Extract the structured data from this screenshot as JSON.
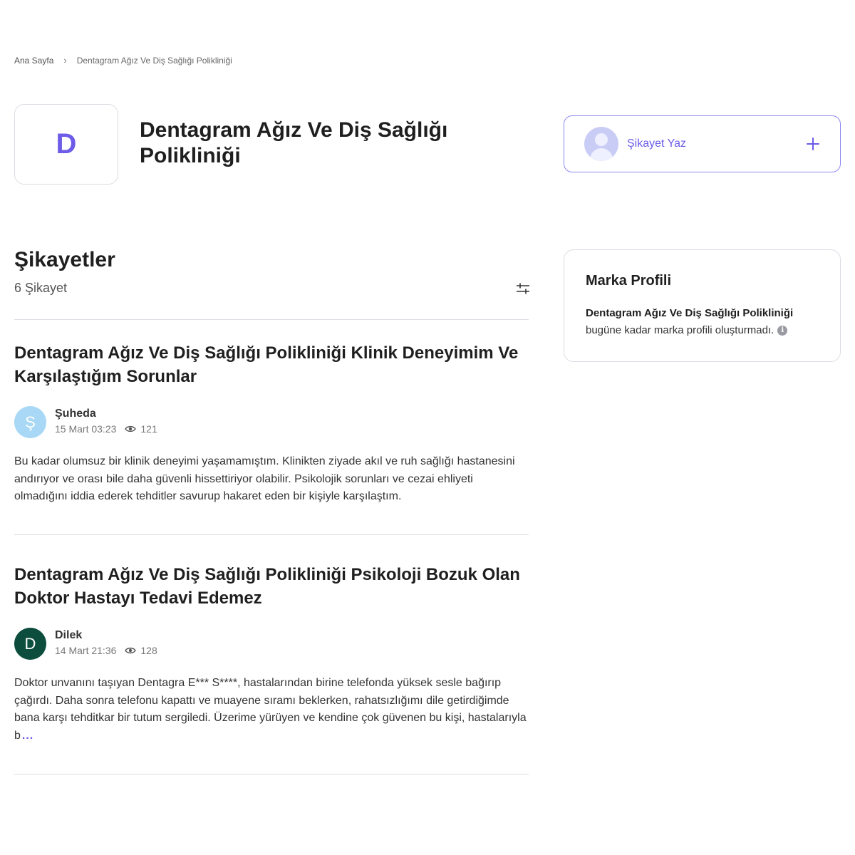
{
  "breadcrumb": {
    "home": "Ana Sayfa",
    "current": "Dentagram Ağız Ve Diş Sağlığı Polikliniği"
  },
  "brand": {
    "logo_letter": "D",
    "name": "Dentagram Ağız Ve Diş Sağlığı Polikliniği",
    "logo_color": "#6c5ce7"
  },
  "write_complaint": {
    "label": "Şikayet Yaz",
    "icon": "plus-icon"
  },
  "complaints_section": {
    "title": "Şikayetler",
    "count": "6 Şikayet",
    "filter_icon": "filter-sliders-icon"
  },
  "complaints": [
    {
      "title": "Dentagram Ağız Ve Diş Sağlığı Polikliniği Klinik Deneyimim Ve Karşılaştığım Sorunlar",
      "user": "Şuheda",
      "avatar_letter": "Ş",
      "avatar_bg": "#a8d8f5",
      "avatar_fg": "#ffffff",
      "date": "15 Mart 03:23",
      "views": "121",
      "body": "Bu kadar olumsuz bir klinik deneyimi yaşamamıştım. Klinikten ziyade akıl ve ruh sağlığı hastanesini andırıyor ve orası bile daha güvenli hissettiriyor olabilir. Psikolojik sorunları ve cezai ehliyeti olmadığını iddia ederek tehditler savurup hakaret eden bir kişiyle karşılaştım."
    },
    {
      "title": "Dentagram Ağız Ve Diş Sağlığı Polikliniği Psikoloji Bozuk Olan Doktor Hastayı Tedavi Edemez",
      "user": "Dilek",
      "avatar_letter": "D",
      "avatar_bg": "#0d4d3d",
      "avatar_fg": "#ffffff",
      "date": "14 Mart 21:36",
      "views": "128",
      "body": "Doktor unvanını taşıyan Dentagra E*** S****, hastalarından birine telefonda yüksek sesle bağırıp çağırdı. Daha sonra telefonu kapattı ve muayene sıramı beklerken, rahatsızlığımı dile getirdiğimde bana karşı tehditkar bir tutum sergiledi. Üzerime yürüyen ve kendine çok güvenen bu kişi, hastalarıyla b",
      "more": "..."
    }
  ],
  "profile_card": {
    "title": "Marka Profili",
    "brand_name": "Dentagram Ağız Ve Diş Sağlığı Polikliniği",
    "text": "bugüne kadar marka profili oluşturmadı.",
    "info_icon": "i"
  }
}
